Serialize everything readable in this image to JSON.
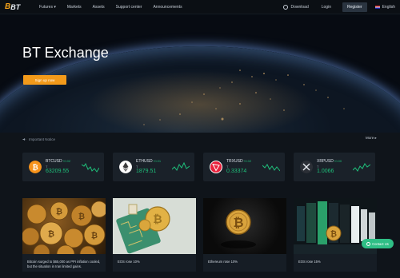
{
  "nav": {
    "logo_mark": "B",
    "logo_text": "BT",
    "items": [
      "Futures ▾",
      "Markets",
      "Assets",
      "Support center",
      "Announcements"
    ],
    "download": "Download",
    "login": "Login",
    "register": "Register",
    "language": "English"
  },
  "hero": {
    "title": "BT Exchange",
    "signup": "Sign up now"
  },
  "notice": {
    "label": "Important Notice",
    "more": "More ▸"
  },
  "tickers": [
    {
      "pair": "BTCUSD",
      "pct": "+0.02",
      "t": "T",
      "price": "63209.55",
      "coin_color": "#f7931a",
      "icon": "bitcoin-icon"
    },
    {
      "pair": "ETHUSD",
      "pct": "+0.01",
      "t": "T",
      "price": "1879.51",
      "coin_color": "#ffffff",
      "icon": "ethereum-icon"
    },
    {
      "pair": "TRXUSD",
      "pct": "+0.02",
      "t": "T",
      "price": "0.33374",
      "coin_color": "#e8223c",
      "icon": "tron-icon"
    },
    {
      "pair": "XRPUSD",
      "pct": "+0.00",
      "t": "T",
      "price": "1.0066",
      "coin_color": "#2b2f36",
      "icon": "xrp-icon"
    }
  ],
  "news": [
    {
      "caption": "Bitcoin surged to $65,000 as PPI inflation cooled, but the situation in Iran limited gains."
    },
    {
      "caption": "EOS rose 10%"
    },
    {
      "caption": "Ethereum rose 10%"
    },
    {
      "caption": "EOS rose 15%"
    }
  ],
  "contact": "Contact Us",
  "colors": {
    "accent": "#f39a1a",
    "up": "#1fbf7a",
    "bg": "#0f141a"
  }
}
